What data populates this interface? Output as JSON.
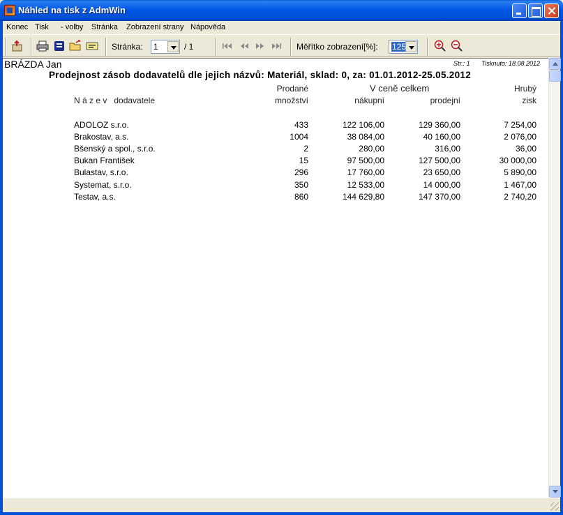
{
  "window": {
    "title": "Náhled na tisk z AdmWin"
  },
  "menu": [
    {
      "label": "Konec"
    },
    {
      "label": "Tisk"
    },
    {
      "label": "- volby"
    },
    {
      "label": "Stránka"
    },
    {
      "label": "Zobrazení strany"
    },
    {
      "label": "Nápověda"
    }
  ],
  "toolbar": {
    "page_label": "Stránka:",
    "page_value": "1",
    "page_total": "/ 1",
    "zoom_label": "Měřítko zobrazení[%]:",
    "zoom_value": "125",
    "icons": [
      "exit-icon",
      "print-icon",
      "print-setup-icon",
      "open-icon",
      "export-icon",
      "first-page-icon",
      "prev-page-icon",
      "next-page-icon",
      "last-page-icon",
      "zoom-in-icon",
      "zoom-out-icon"
    ]
  },
  "document": {
    "header_name": "BRÁZDA Jan",
    "page_info": "Str.: 1",
    "printed_info": "Tisknuto: 18.08.2012",
    "report_title": "Prodejnost zásob dodavatelů dle jejich názvů: Materiál, sklad:  0, za: 01.01.2012-25.05.2012",
    "columns": {
      "name": "N á z e v   dodavatele",
      "sold_top": "Prodané",
      "sold_bottom": "množství",
      "price_group": "V ceně celkem",
      "purchase": "nákupní",
      "sale": "prodejní",
      "profit_top": "Hrubý",
      "profit_bottom": "zisk"
    },
    "rows": [
      {
        "name": "ADOLOZ s.r.o.",
        "qty": "433",
        "purchase": "122 106,00",
        "sale": "129 360,00",
        "profit": "7 254,00"
      },
      {
        "name": "Brakostav, a.s.",
        "qty": "1004",
        "purchase": "38 084,00",
        "sale": "40 160,00",
        "profit": "2 076,00"
      },
      {
        "name": "Bšenský a spol., s.r.o.",
        "qty": "2",
        "purchase": "280,00",
        "sale": "316,00",
        "profit": "36,00"
      },
      {
        "name": "Bukan František",
        "qty": "15",
        "purchase": "97 500,00",
        "sale": "127 500,00",
        "profit": "30 000,00"
      },
      {
        "name": "Bulastav, s.r.o.",
        "qty": "296",
        "purchase": "17 760,00",
        "sale": "23 650,00",
        "profit": "5 890,00"
      },
      {
        "name": "Systemat, s.r.o.",
        "qty": "350",
        "purchase": "12 533,00",
        "sale": "14 000,00",
        "profit": "1 467,00"
      },
      {
        "name": "Testav, a.s.",
        "qty": "860",
        "purchase": "144 629,80",
        "sale": "147 370,00",
        "profit": "2 740,20"
      }
    ]
  }
}
